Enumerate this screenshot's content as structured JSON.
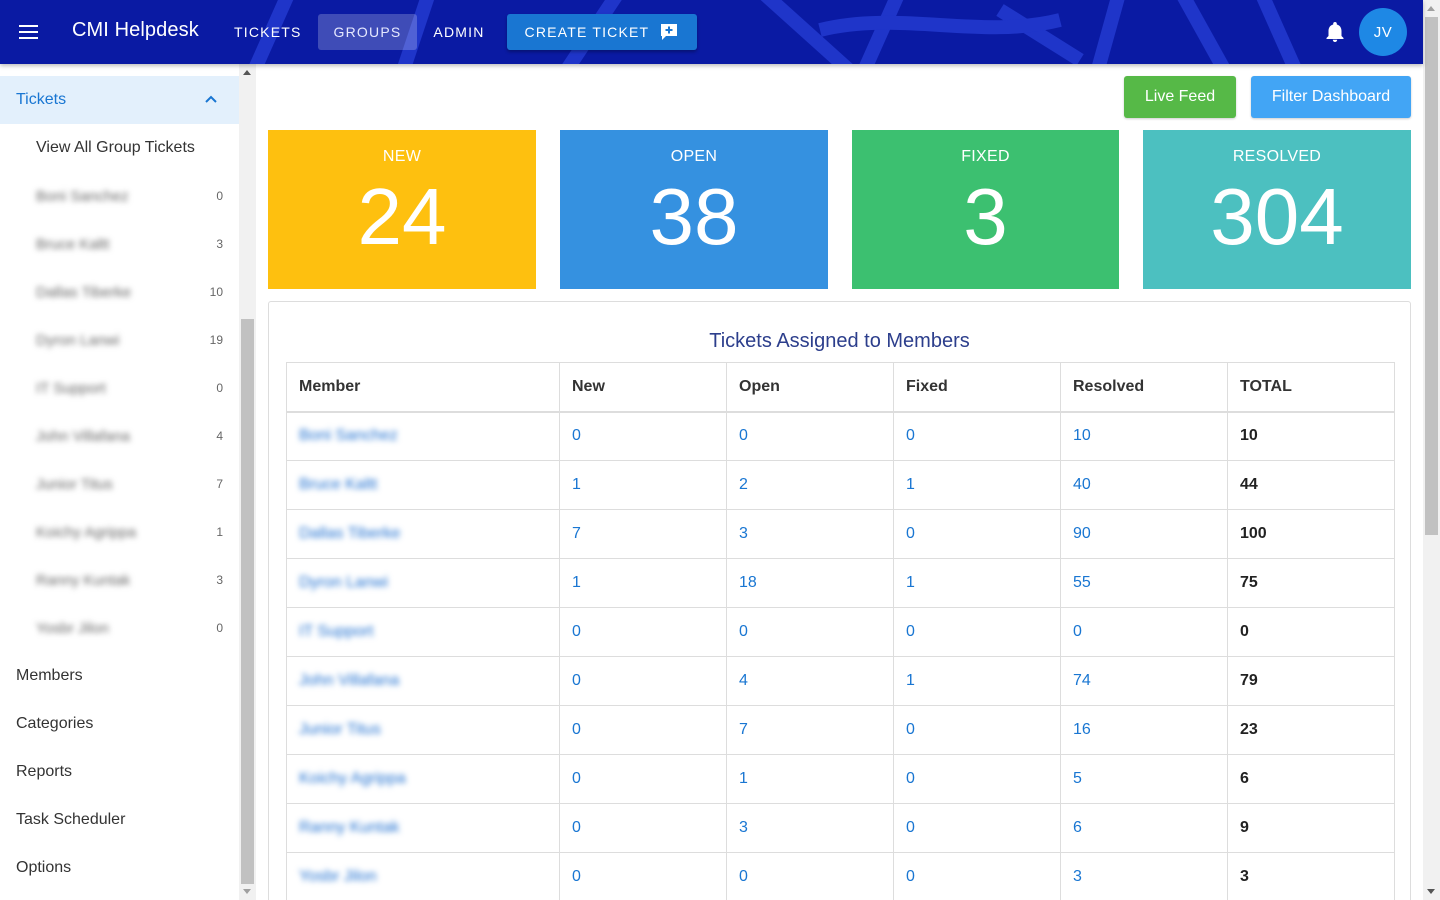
{
  "app": {
    "title": "CMI Helpdesk"
  },
  "nav": {
    "tickets": "TICKETS",
    "groups": "GROUPS",
    "admin": "ADMIN",
    "create_ticket": "CREATE TICKET"
  },
  "user": {
    "initials": "JV"
  },
  "colors": {
    "topbar": "#0a1aa3",
    "new": "#fec00f",
    "open": "#3591e0",
    "fixed": "#3cc070",
    "resolved": "#4cc0c0",
    "live_feed": "#56b947",
    "filter": "#42a5f5",
    "link": "#1976d2"
  },
  "sidebar": {
    "group_label": "Tickets",
    "view_all": "View All Group Tickets",
    "members": [
      {
        "name": "Boni Sanchez",
        "count": "0"
      },
      {
        "name": "Bruce Kaltt",
        "count": "3"
      },
      {
        "name": "Dallas Tiberke",
        "count": "10"
      },
      {
        "name": "Dyron Lanwi",
        "count": "19"
      },
      {
        "name": "IT Support",
        "count": "0"
      },
      {
        "name": "John Villafana",
        "count": "4"
      },
      {
        "name": "Junior Titus",
        "count": "7"
      },
      {
        "name": "Koichy Agrippa",
        "count": "1"
      },
      {
        "name": "Ranny Kuntak",
        "count": "3"
      },
      {
        "name": "Yosbr Jilon",
        "count": "0"
      }
    ],
    "links": [
      "Members",
      "Categories",
      "Reports",
      "Task Scheduler",
      "Options"
    ]
  },
  "actions": {
    "live_feed": "Live Feed",
    "filter_dashboard": "Filter Dashboard"
  },
  "stats": {
    "new": {
      "label": "NEW",
      "value": "24"
    },
    "open": {
      "label": "OPEN",
      "value": "38"
    },
    "fixed": {
      "label": "FIXED",
      "value": "3"
    },
    "resolved": {
      "label": "RESOLVED",
      "value": "304"
    }
  },
  "table": {
    "title": "Tickets Assigned to Members",
    "headers": [
      "Member",
      "New",
      "Open",
      "Fixed",
      "Resolved",
      "TOTAL"
    ],
    "rows": [
      [
        "Boni Sanchez",
        "0",
        "0",
        "0",
        "10",
        "10"
      ],
      [
        "Bruce Kaltt",
        "1",
        "2",
        "1",
        "40",
        "44"
      ],
      [
        "Dallas Tiberke",
        "7",
        "3",
        "0",
        "90",
        "100"
      ],
      [
        "Dyron Lanwi",
        "1",
        "18",
        "1",
        "55",
        "75"
      ],
      [
        "IT Support",
        "0",
        "0",
        "0",
        "0",
        "0"
      ],
      [
        "John Villafana",
        "0",
        "4",
        "1",
        "74",
        "79"
      ],
      [
        "Junior Titus",
        "0",
        "7",
        "0",
        "16",
        "23"
      ],
      [
        "Koichy Agrippa",
        "0",
        "1",
        "0",
        "5",
        "6"
      ],
      [
        "Ranny Kuntak",
        "0",
        "3",
        "0",
        "6",
        "9"
      ],
      [
        "Yosbr Jilon",
        "0",
        "0",
        "0",
        "3",
        "3"
      ]
    ]
  }
}
